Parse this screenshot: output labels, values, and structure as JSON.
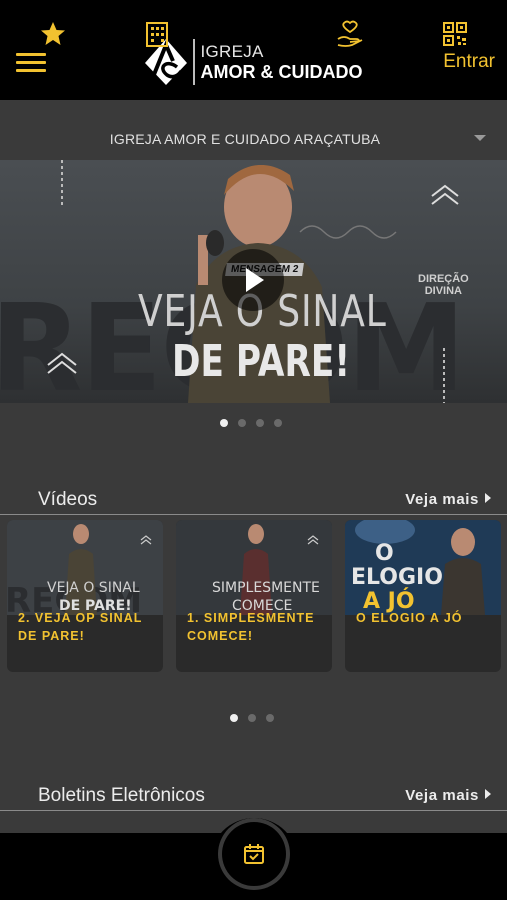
{
  "header": {
    "logo_line1": "IGREJA",
    "logo_line2": "AMOR & CUIDADO",
    "login_label": "Entrar"
  },
  "church_selector": {
    "selected": "IGREJA AMOR E CUIDADO ARAÇATUBA"
  },
  "banner": {
    "message_tag": "MENSAGEM 2",
    "title_line1": "VEJA O SINAL",
    "title_line2": "DE PARE!",
    "series_label_line1": "DIREÇÃO",
    "series_label_line2": "DIVINA",
    "slides_total": 4,
    "active_slide": 1
  },
  "videos": {
    "section_title": "Vídeos",
    "see_more": "Veja mais",
    "items": [
      {
        "caption": "2. VEJA OP SINAL DE PARE!",
        "thumb_text": "VEJA O SINAL DE PARE!"
      },
      {
        "caption": "1. SIMPLESMENTE COMECE!",
        "thumb_text": "SIMPLESMENTE COMECE"
      },
      {
        "caption": "O ELOGIO A JÓ",
        "thumb_text": "O ELOGIO A JÓ"
      }
    ],
    "pages_total": 3,
    "active_page": 1
  },
  "bulletins": {
    "section_title": "Boletins Eletrônicos",
    "see_more": "Veja mais"
  },
  "bottom_nav": {
    "items": [
      "star-icon",
      "building-icon",
      "calendar-check-icon",
      "donate-hand-icon",
      "qr-code-icon"
    ]
  },
  "colors": {
    "accent": "#f2c230",
    "background": "#3a3a3a",
    "header": "#000000"
  }
}
